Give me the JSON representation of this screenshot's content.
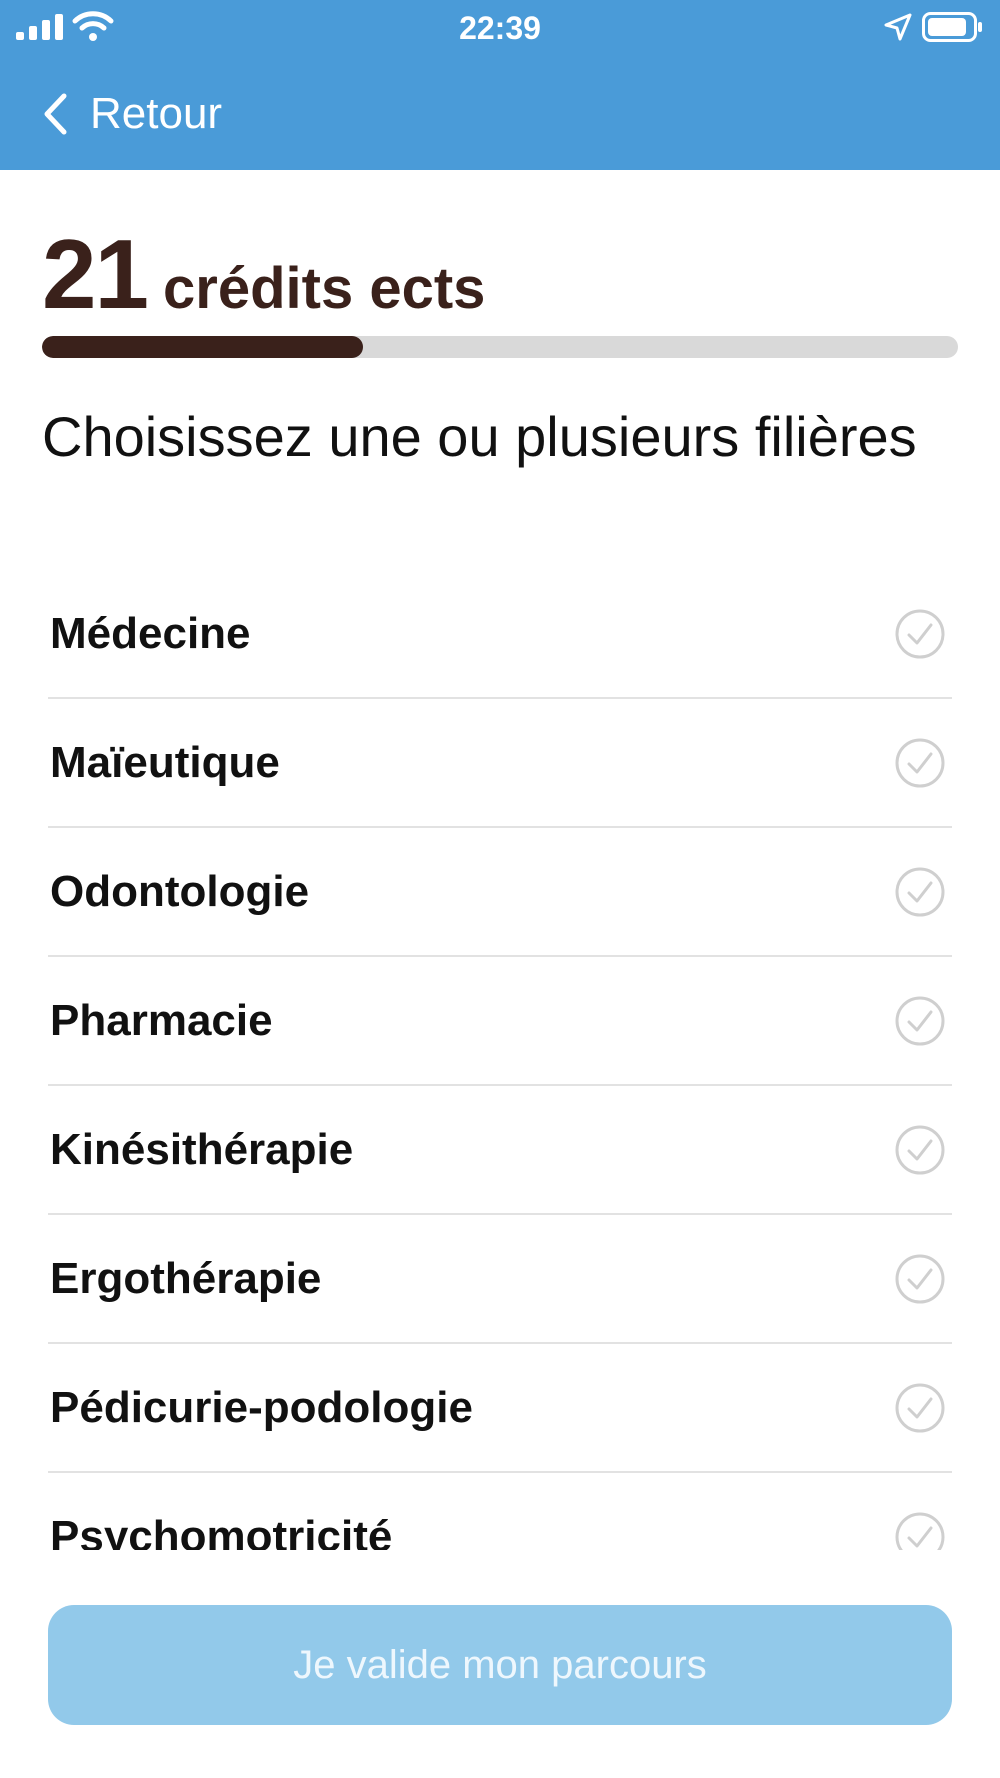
{
  "status_bar": {
    "time": "22:39"
  },
  "nav": {
    "back_label": "Retour"
  },
  "credits": {
    "value": "21",
    "label": "crédits ects",
    "progress_fraction": 0.35
  },
  "heading": "Choisissez une ou plusieurs filières",
  "options": [
    {
      "label": "Médecine"
    },
    {
      "label": "Maïeutique"
    },
    {
      "label": "Odontologie"
    },
    {
      "label": "Pharmacie"
    },
    {
      "label": "Kinésithérapie"
    },
    {
      "label": "Ergothérapie"
    },
    {
      "label": "Pédicurie-podologie"
    },
    {
      "label": "Psychomotricité"
    }
  ],
  "submit_label": "Je valide mon parcours",
  "colors": {
    "header_bg": "#4a9bd8",
    "accent_dark": "#3a211b",
    "button_bg": "#92c9ea",
    "check_gray": "#cfcfcf"
  }
}
